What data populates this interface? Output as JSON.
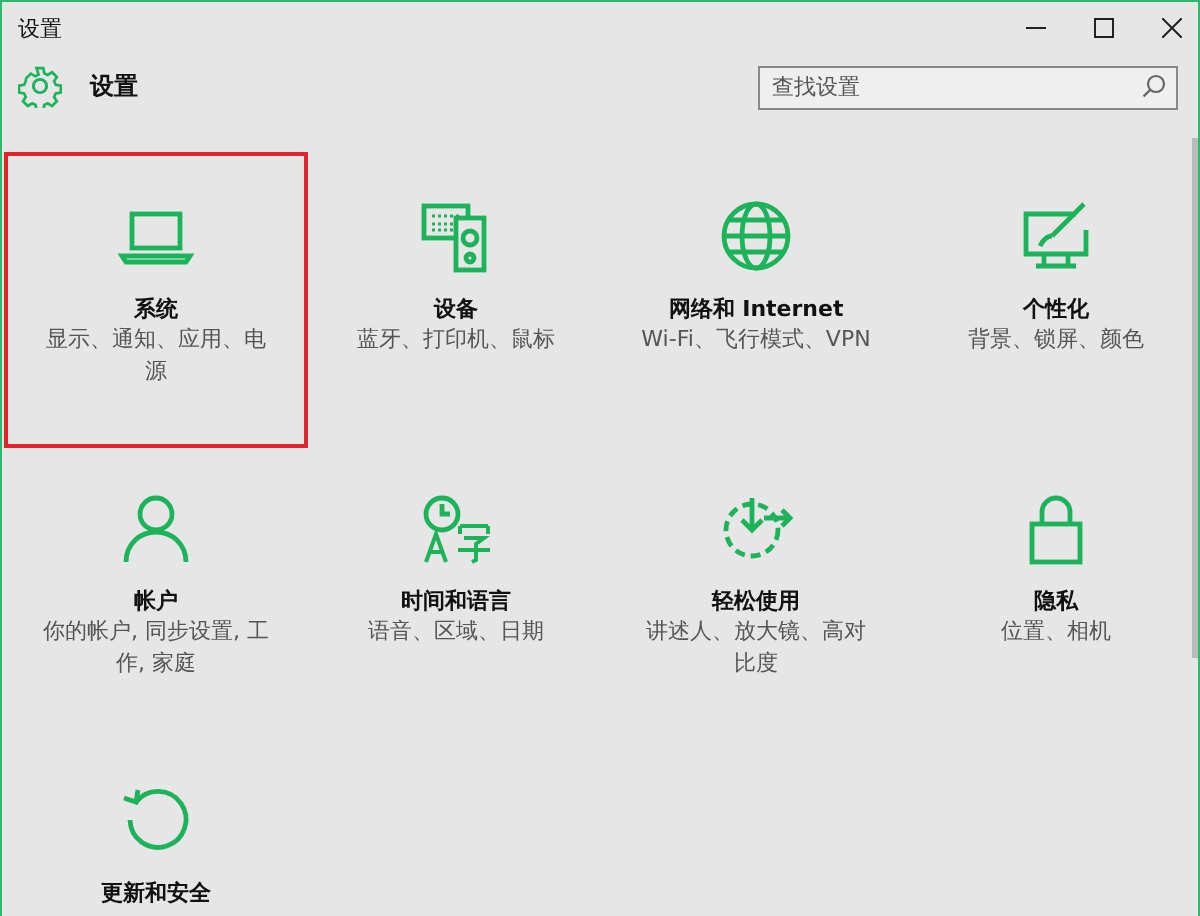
{
  "window": {
    "title": "设置"
  },
  "header": {
    "title": "设置",
    "search": {
      "placeholder": "查找设置"
    }
  },
  "items": [
    {
      "title": "系统",
      "description": "显示、通知、应用、电源",
      "highlighted": true
    },
    {
      "title": "设备",
      "description": "蓝牙、打印机、鼠标",
      "highlighted": false
    },
    {
      "title": "网络和 Internet",
      "description": "Wi-Fi、飞行模式、VPN",
      "highlighted": false
    },
    {
      "title": "个性化",
      "description": "背景、锁屏、颜色",
      "highlighted": false
    },
    {
      "title": "帐户",
      "description": "你的帐户, 同步设置, 工作, 家庭",
      "highlighted": false
    },
    {
      "title": "时间和语言",
      "description": "语音、区域、日期",
      "highlighted": false
    },
    {
      "title": "轻松使用",
      "description": "讲述人、放大镜、高对比度",
      "highlighted": false
    },
    {
      "title": "隐私",
      "description": "位置、相机",
      "highlighted": false
    },
    {
      "title": "更新和安全",
      "highlighted": false
    }
  ]
}
